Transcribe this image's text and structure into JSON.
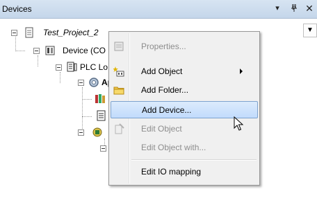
{
  "panel": {
    "title": "Devices"
  },
  "tree": {
    "project": "Test_Project_2",
    "device": "Device (CO",
    "plc_logic": "PLC Lo",
    "application": "Ap"
  },
  "context_menu": {
    "items": [
      {
        "label": "Properties...",
        "icon": "properties-icon",
        "enabled": false
      },
      {
        "label": "Add Object",
        "icon": "add-object-icon",
        "enabled": true,
        "submenu": true
      },
      {
        "label": "Add Folder...",
        "icon": "folder-icon",
        "enabled": true
      },
      {
        "label": "Add Device...",
        "icon": "",
        "enabled": true,
        "highlighted": true
      },
      {
        "label": "Edit Object",
        "icon": "edit-object-icon",
        "enabled": false
      },
      {
        "label": "Edit Object with...",
        "icon": "",
        "enabled": false
      },
      {
        "label": "Edit IO mapping",
        "icon": "",
        "enabled": true
      }
    ]
  },
  "colors": {
    "menu_background": "#f0f0f0",
    "highlight": "#c1dbfc",
    "disabled_text": "#8d8d8d",
    "titlebar": "#c4d6ea"
  }
}
